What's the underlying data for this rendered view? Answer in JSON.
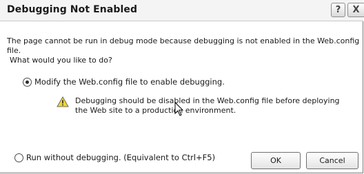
{
  "dialog": {
    "title": "Debugging Not Enabled",
    "help_label": "?",
    "close_label": "X"
  },
  "message": {
    "line1": "The page cannot be run in debug mode because debugging is not enabled in the Web.config file.",
    "line2": "What would you like to do?"
  },
  "options": [
    {
      "label": "Modify the Web.config file to enable debugging.",
      "selected": true
    },
    {
      "label": "Run without debugging. (Equivalent to Ctrl+F5)",
      "selected": false
    }
  ],
  "warning": {
    "icon": "warning-icon",
    "text": "Debugging should be disabled in the Web.config file before deploying the Web site to a production environment."
  },
  "buttons": {
    "ok": "OK",
    "cancel": "Cancel"
  }
}
